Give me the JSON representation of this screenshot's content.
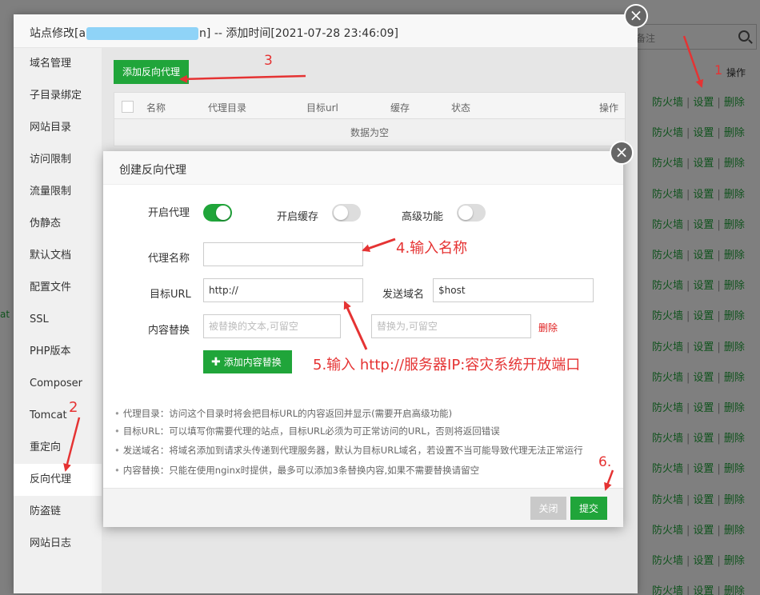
{
  "background": {
    "search_placeholder": "备注",
    "op_header": "操作",
    "row_actions": [
      "防火墙",
      "设置",
      "删除"
    ],
    "left_text": "at"
  },
  "site_panel": {
    "title_prefix": "站点修改[a",
    "title_suffix": "n] -- 添加时间[2021-07-28 23:46:09]",
    "sidebar": [
      "域名管理",
      "子目录绑定",
      "网站目录",
      "访问限制",
      "流量限制",
      "伪静态",
      "默认文档",
      "配置文件",
      "SSL",
      "PHP版本",
      "Composer",
      "Tomcat",
      "重定向",
      "反向代理",
      "防盗链",
      "网站日志"
    ],
    "active_item": "反向代理",
    "add_proxy_button": "添加反向代理",
    "table_headers": [
      "名称",
      "代理目录",
      "目标url",
      "缓存",
      "状态",
      "操作"
    ],
    "table_empty": "数据为空"
  },
  "modal": {
    "title": "创建反向代理",
    "enable_proxy_label": "开启代理",
    "enable_proxy": true,
    "enable_cache_label": "开启缓存",
    "enable_cache": false,
    "advanced_label": "高级功能",
    "advanced": false,
    "proxy_name_label": "代理名称",
    "proxy_name_value": "",
    "target_url_label": "目标URL",
    "target_url_value": "http://",
    "send_domain_label": "发送域名",
    "send_domain_value": "$host",
    "content_replace_label": "内容替换",
    "replace_from_placeholder": "被替换的文本,可留空",
    "replace_to_placeholder": "替换为,可留空",
    "delete_link": "删除",
    "add_replace_button": "添加内容替换",
    "tips": [
      "代理目录：访问这个目录时将会把目标URL的内容返回并显示(需要开启高级功能)",
      "目标URL：可以填写你需要代理的站点，目标URL必须为可正常访问的URL，否则将返回错误",
      "发送域名：将域名添加到请求头传递到代理服务器，默认为目标URL域名，若设置不当可能导致代理无法正常运行",
      "内容替换：只能在使用nginx时提供，最多可以添加3条替换内容,如果不需要替换请留空"
    ],
    "close_button": "关闭",
    "submit_button": "提交"
  },
  "annotations": {
    "step1": "1",
    "step2": "2",
    "step3": "3",
    "step4": "4.输入名称",
    "step5": "5.输入 http://服务器IP:容灾系统开放端口",
    "step6": "6."
  },
  "colors": {
    "accent_green": "#20a53a",
    "annotation_red": "#e53333",
    "blur_blue": "#8fd3f7"
  }
}
